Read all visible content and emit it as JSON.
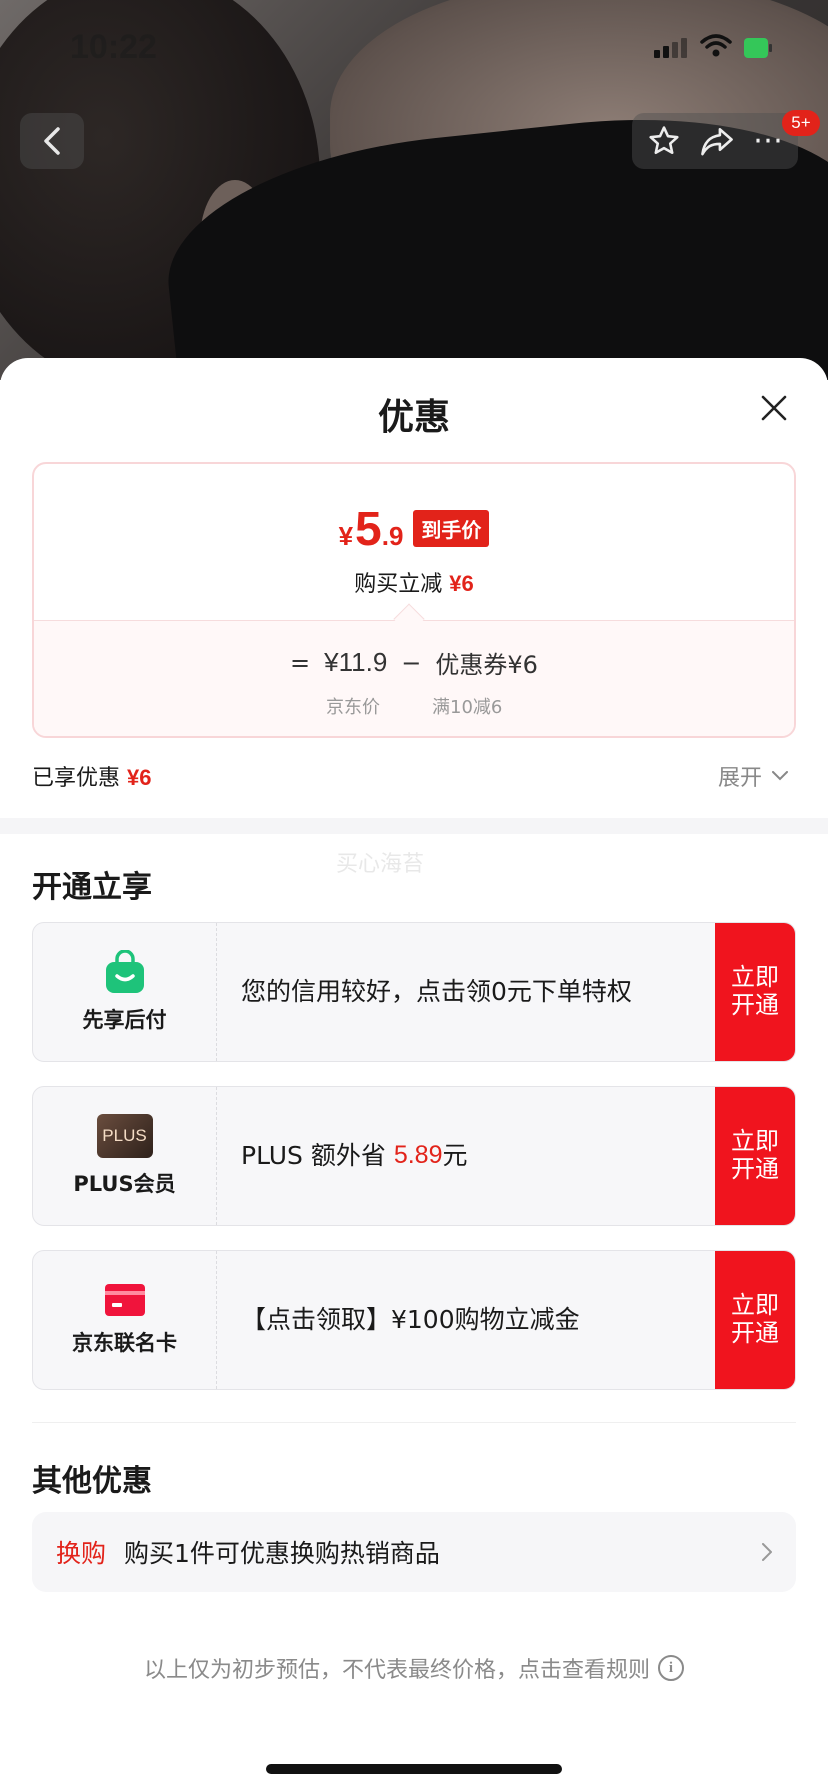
{
  "status_bar": {
    "time": "10:22"
  },
  "nav": {
    "back_icon": "chevron-left-icon",
    "cart_badge": "5+"
  },
  "sheet": {
    "title": "优惠",
    "price_card": {
      "final_currency": "¥",
      "final_int": "5",
      "final_dec": ".9",
      "final_tag": "到手价",
      "reduce_label": "购买立减",
      "reduce_value": "¥6",
      "formula_eq": "=",
      "jd_price": "¥11.9",
      "formula_minus": "−",
      "coupon": "优惠券¥6",
      "jd_price_label": "京东价",
      "coupon_label": "满10减6"
    },
    "enjoyed_label": "已享优惠",
    "enjoyed_value": "¥6",
    "expand_label": "展开",
    "watermark": "买心海苔"
  },
  "open_section": {
    "title": "开通立享",
    "offers": [
      {
        "label": "先享后付",
        "icon": "shopping-bag-icon",
        "desc": "您的信用较好，点击领0元下单特权",
        "button": "立即开通"
      },
      {
        "label": "PLUS会员",
        "icon": "plus-icon",
        "icon_text": "PLUS",
        "desc_prefix": "PLUS 额外省 ",
        "desc_value": "5.89",
        "desc_suffix": "元",
        "button": "立即开通"
      },
      {
        "label": "京东联名卡",
        "icon": "credit-card-icon",
        "desc": "【点击领取】¥100购物立减金",
        "button": "立即开通"
      }
    ]
  },
  "other_section": {
    "title": "其他优惠",
    "row_tag": "换购",
    "row_text": "购买1件可优惠换购热销商品"
  },
  "footer_note": "以上仅为初步预估，不代表最终价格，点击查看规则",
  "colors": {
    "accent_red": "#e2231a",
    "button_red": "#f0141e"
  }
}
